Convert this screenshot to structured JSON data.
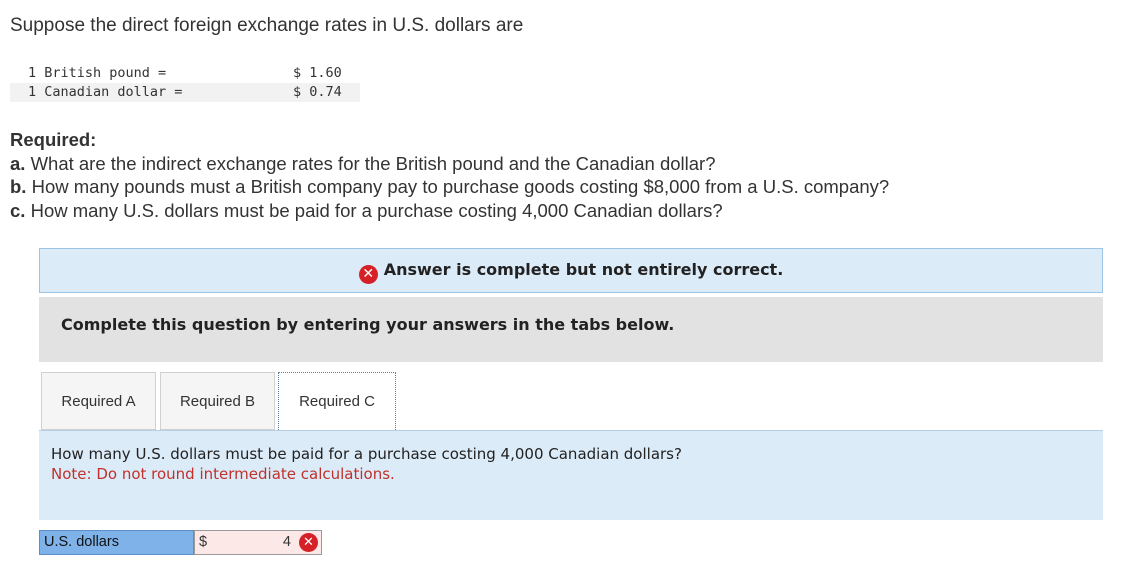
{
  "intro": "Suppose the direct foreign exchange rates in U.S. dollars are",
  "rates": [
    {
      "label": "1 British pound =",
      "value": "$ 1.60"
    },
    {
      "label": "1 Canadian dollar =",
      "value": "$ 0.74"
    }
  ],
  "required": {
    "title": "Required:",
    "a_letter": "a.",
    "a_text": "What are the indirect exchange rates for the British pound and the Canadian dollar?",
    "b_letter": "b.",
    "b_text": "How many pounds must a British company pay to purchase goods costing $8,000 from a U.S. company?",
    "c_letter": "c.",
    "c_text": "How many U.S. dollars must be paid for a purchase costing 4,000 Canadian dollars?"
  },
  "banner": {
    "icon": "x-circle-icon",
    "text": "Answer is complete but not entirely correct.",
    "color": "#d62027"
  },
  "instruction": "Complete this question by entering your answers in the tabs below.",
  "tabs": [
    {
      "label": "Required A"
    },
    {
      "label": "Required B"
    },
    {
      "label": "Required C"
    }
  ],
  "panel": {
    "question": "How many U.S. dollars must be paid for a purchase costing 4,000 Canadian dollars?",
    "note": "Note: Do not round intermediate calculations."
  },
  "answer": {
    "label": "U.S. dollars",
    "currency": "$",
    "value": "4",
    "status": "incorrect"
  }
}
